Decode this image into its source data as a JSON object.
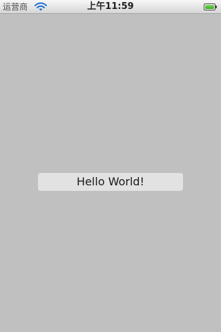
{
  "status_bar": {
    "carrier": "运营商",
    "time": "上午11:59",
    "wifi_icon": "wifi-icon",
    "battery_icon": "battery-icon",
    "battery_level": 1.0,
    "battery_color": "#4cbf2a"
  },
  "main": {
    "button_label": "Hello World!"
  },
  "colors": {
    "background": "#c0c0c0",
    "button_background": "#e2e2e2"
  }
}
